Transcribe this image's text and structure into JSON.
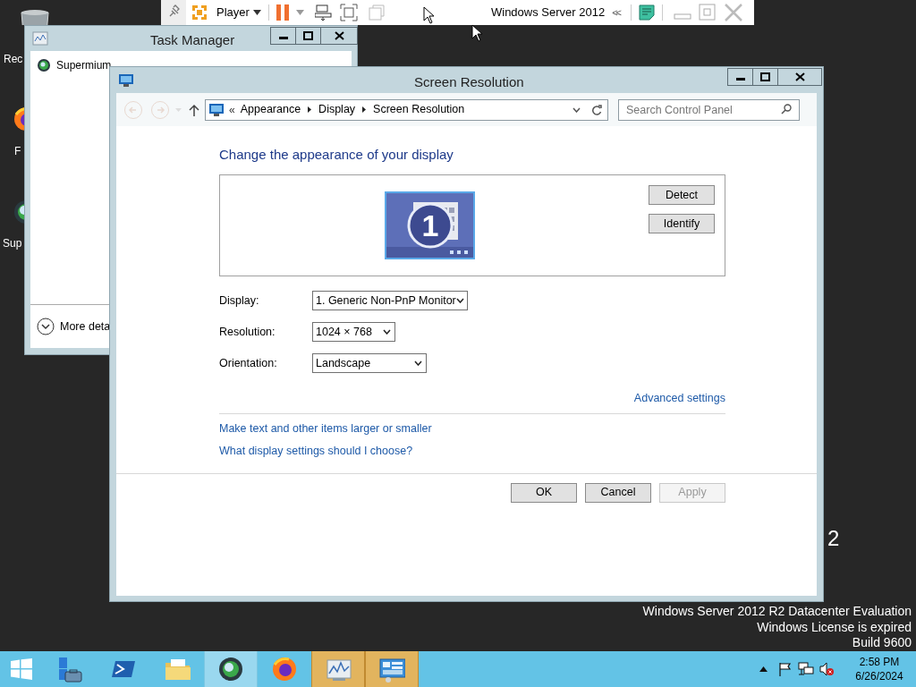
{
  "vm_toolbar": {
    "menu": "Player",
    "title": "Windows Server 2012",
    "collapse": "<<"
  },
  "desktop_icons": [
    {
      "kind": "recycle-bin",
      "label": "Rec"
    },
    {
      "kind": "firefox",
      "label": "F"
    },
    {
      "kind": "supermium",
      "label": "Sup"
    }
  ],
  "task_manager": {
    "title": "Task Manager",
    "apps": [
      "Supermium"
    ],
    "more_details": "More deta"
  },
  "screen_resolution": {
    "title": "Screen Resolution",
    "breadcrumb": {
      "overflow": "«",
      "items": [
        "Appearance",
        "Display",
        "Screen Resolution"
      ]
    },
    "search": {
      "placeholder": "Search Control Panel"
    },
    "heading": "Change the appearance of your display",
    "monitor": {
      "number": "1"
    },
    "monitor_buttons": [
      "Detect",
      "Identify"
    ],
    "fields": [
      {
        "label": "Display:",
        "value": "1. Generic Non-PnP Monitor"
      },
      {
        "label": "Resolution:",
        "value": "1024 × 768"
      },
      {
        "label": "Orientation:",
        "value": "Landscape"
      }
    ],
    "advanced_link": "Advanced settings",
    "links": [
      "Make text and other items larger or smaller",
      "What display settings should I choose?"
    ],
    "buttons": [
      {
        "label": "OK",
        "disabled": false
      },
      {
        "label": "Cancel",
        "disabled": false
      },
      {
        "label": "Apply",
        "disabled": true
      }
    ]
  },
  "desktop_watermark": {
    "partial": "2",
    "lines": [
      "Windows Server 2012 R2 Datacenter Evaluation",
      "Windows License is expired",
      "Build 9600"
    ]
  },
  "taskbar": {
    "apps": [
      {
        "kind": "server-manager",
        "active": false,
        "highlighted": false
      },
      {
        "kind": "powershell",
        "active": false,
        "highlighted": false
      },
      {
        "kind": "file-explorer",
        "active": false,
        "highlighted": false
      },
      {
        "kind": "supermium",
        "active": true,
        "highlighted": false
      },
      {
        "kind": "firefox",
        "active": false,
        "highlighted": false
      },
      {
        "kind": "performance-monitor",
        "active": false,
        "highlighted": true
      },
      {
        "kind": "control-panel",
        "active": false,
        "highlighted": true
      }
    ],
    "time": "2:58 PM",
    "date": "6/26/2024"
  }
}
